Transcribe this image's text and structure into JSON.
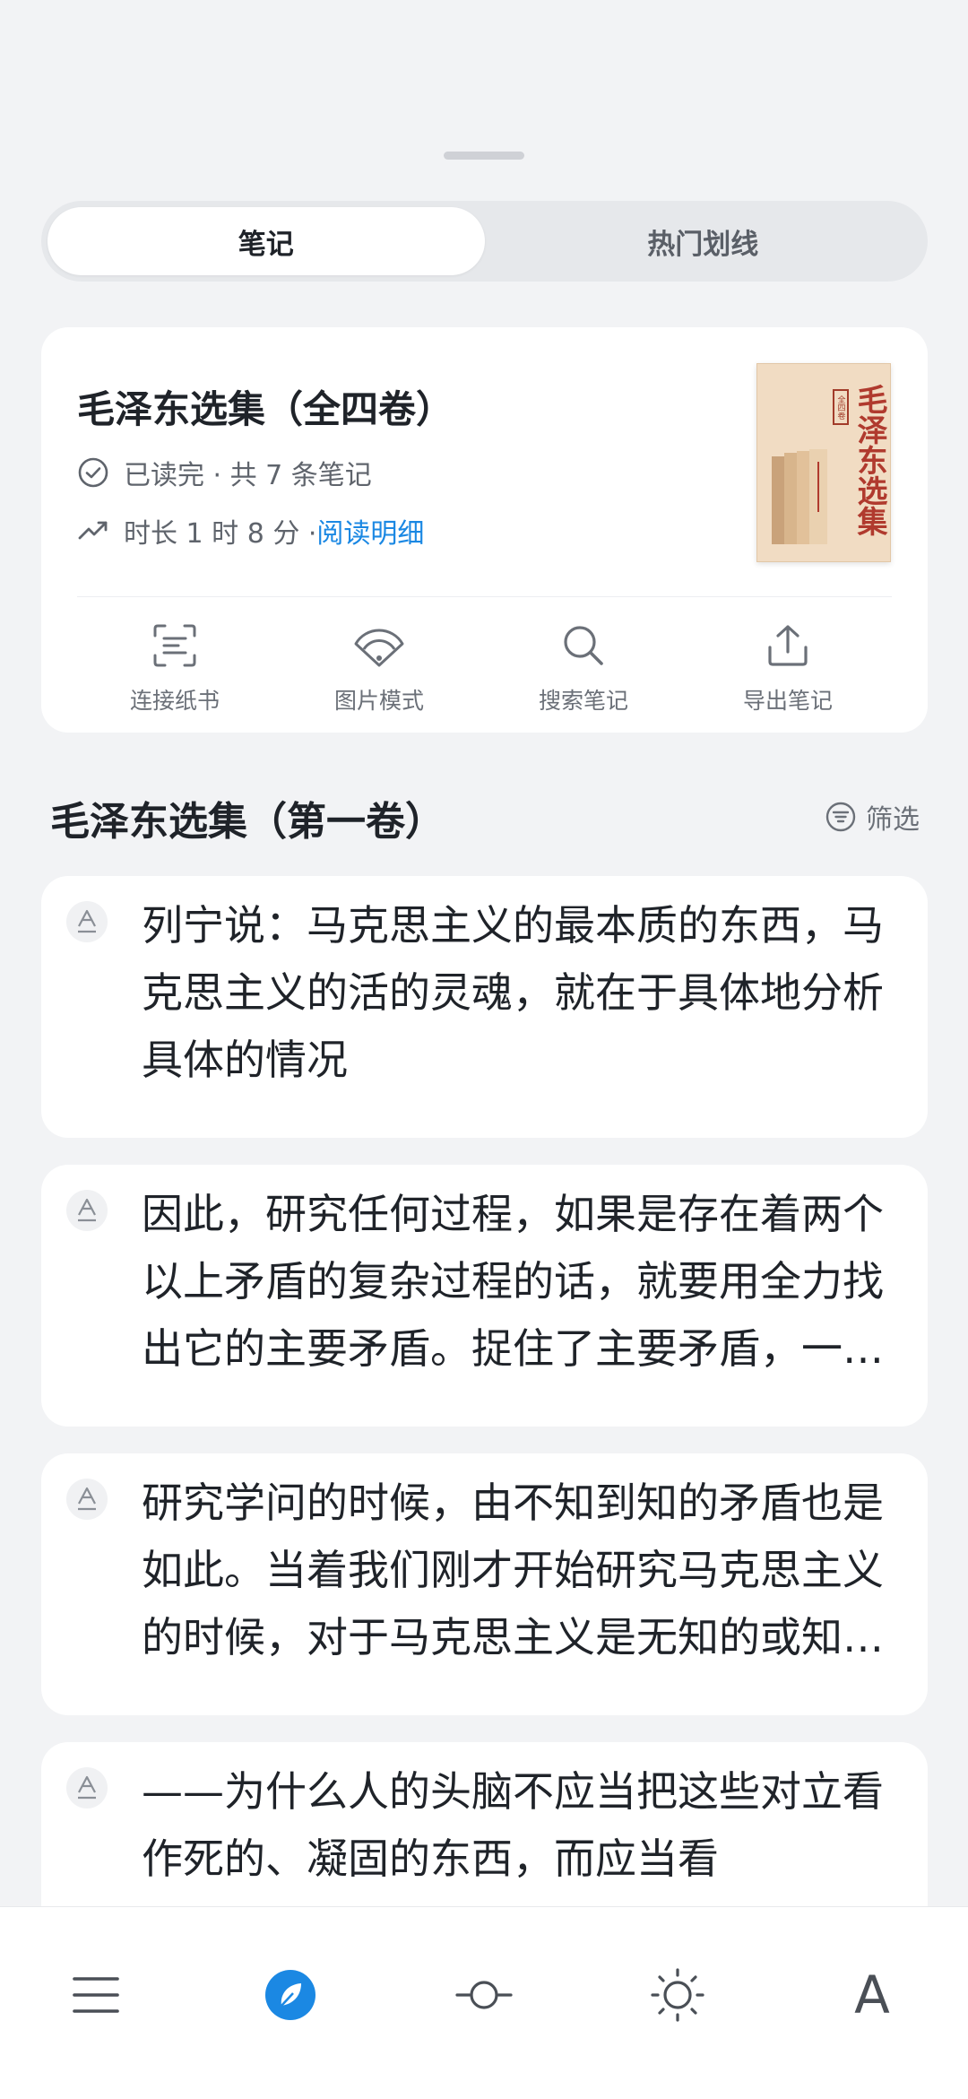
{
  "tabs": {
    "notes": "笔记",
    "hot": "热门划线"
  },
  "book": {
    "title": "毛泽东选集（全四卷）",
    "status": "已读完 · 共 7 条笔记",
    "duration": "时长 1 时 8 分 · ",
    "detail_link": "阅读明细",
    "cover": {
      "tag": "全四卷",
      "title": "毛泽东选集"
    }
  },
  "actions": [
    {
      "label": "连接纸书",
      "icon": "scan-icon"
    },
    {
      "label": "图片模式",
      "icon": "fan-icon"
    },
    {
      "label": "搜索笔记",
      "icon": "search-icon"
    },
    {
      "label": "导出笔记",
      "icon": "export-icon"
    }
  ],
  "section": {
    "title": "毛泽东选集（第一卷）",
    "filter": "筛选"
  },
  "notes": [
    "列宁说：马克思主义的最本质的东西，马克思主义的活的灵魂，就在于具体地分析具体的情况",
    "因此，研究任何过程，如果是存在着两个以上矛盾的复杂过程的话，就要用全力找出它的主要矛盾。捉住了主要矛盾，一切问题就迎刃而解了。",
    "研究学问的时候，由不知到知的矛盾也是如此。当着我们刚才开始研究马克思主义的时候，对于马克思主义是无知的或知之不多的。",
    "——为什么人的头脑不应当把这些对立看作死的、凝固的东西，而应当看"
  ],
  "bottom_bar": {
    "items": [
      "menu-icon",
      "compass-icon",
      "progress-icon",
      "brightness-icon",
      "font-icon"
    ],
    "font_label": "A"
  },
  "colors": {
    "accent": "#1b88e3",
    "background": "#f2f3f5",
    "card": "#ffffff"
  }
}
